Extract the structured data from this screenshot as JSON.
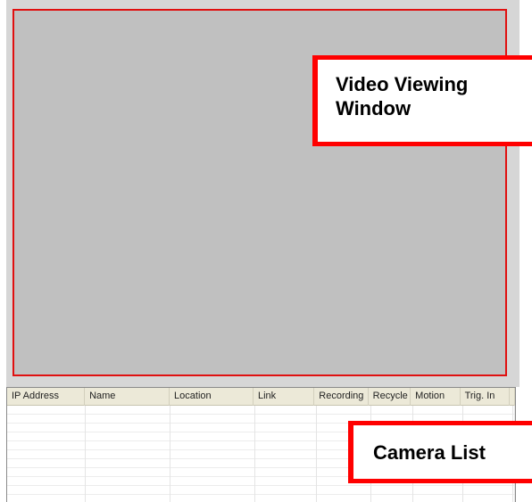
{
  "video_window": {
    "callout_line1": "Video Viewing",
    "callout_line2": "Window"
  },
  "camera_list": {
    "callout": "Camera List",
    "columns": [
      "IP Address",
      "Name",
      "Location",
      "Link",
      "Recording",
      "Recycle",
      "Motion",
      "Trig. In"
    ],
    "rows": []
  },
  "colors": {
    "highlight_red": "#ff0000",
    "viewer_gray": "#c0c0c0",
    "header_beige": "#ece9d8"
  }
}
